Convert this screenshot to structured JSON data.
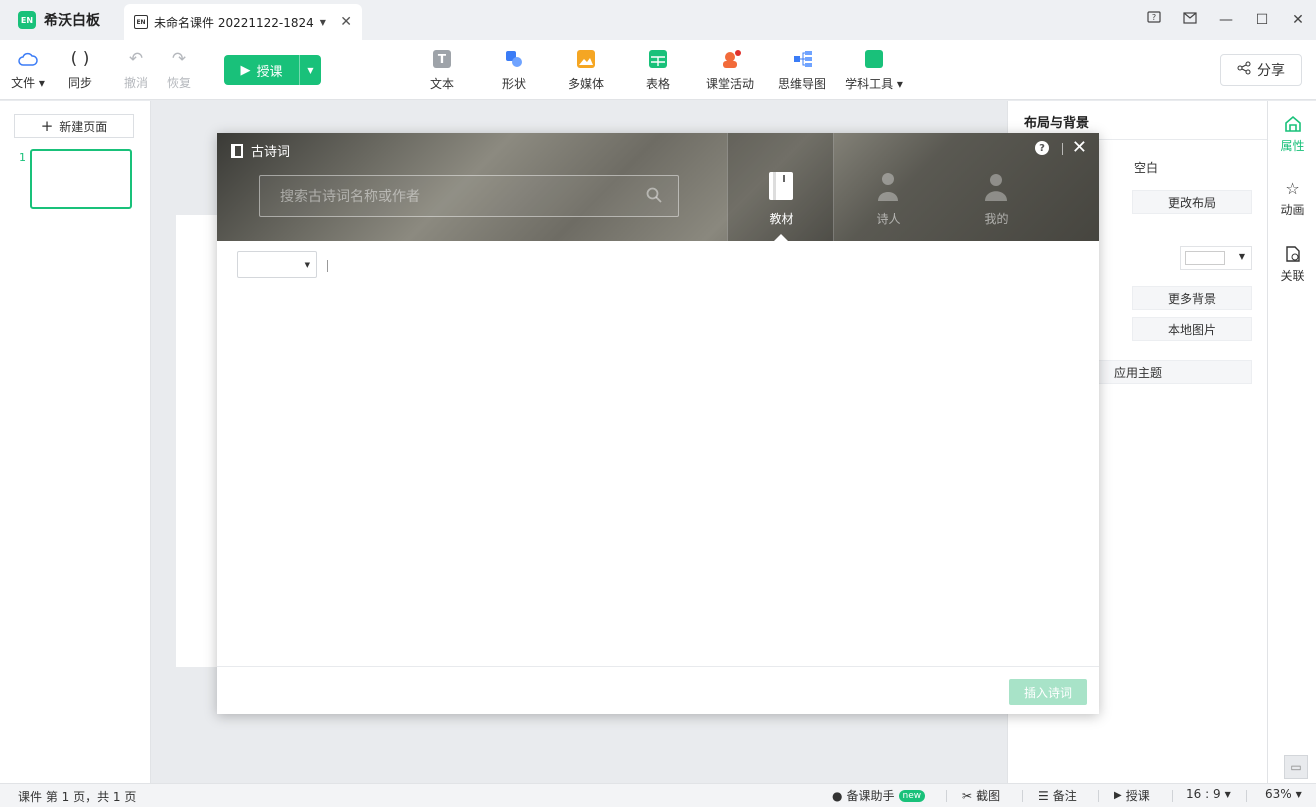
{
  "app": {
    "name": "希沃白板",
    "logo_text": "EN"
  },
  "document_tab": {
    "icon_text": "EN",
    "title": "未命名课件 20221122-1824"
  },
  "toolbar": {
    "file": "文件",
    "sync": "同步",
    "undo": "撤消",
    "redo": "恢复",
    "teach": "授课",
    "insert_items": [
      {
        "label": "文本",
        "icon": "text-icon",
        "color": "#9ea3a9"
      },
      {
        "label": "形状",
        "icon": "shape-icon",
        "color": "#3b7cf6"
      },
      {
        "label": "多媒体",
        "icon": "media-icon",
        "color": "#f5a623"
      },
      {
        "label": "表格",
        "icon": "table-icon",
        "color": "#19c17a"
      },
      {
        "label": "课堂活动",
        "icon": "activity-icon",
        "color": "#f26b3a"
      },
      {
        "label": "思维导图",
        "icon": "mindmap-icon",
        "color": "#3b7cf6"
      },
      {
        "label": "学科工具",
        "icon": "subject-tools-icon",
        "color": "#19c17a"
      }
    ],
    "share": "分享"
  },
  "left_panel": {
    "new_page": "新建页面",
    "page_number": "1"
  },
  "properties": {
    "title": "布局与背景",
    "layout_name": "空白",
    "change_layout": "更改布局",
    "more_backgrounds": "更多背景",
    "local_image": "本地图片",
    "apply_theme": "应用主题"
  },
  "side_tabs": [
    {
      "label": "属性",
      "icon": "properties-icon",
      "active": true
    },
    {
      "label": "动画",
      "icon": "star-icon",
      "active": false
    },
    {
      "label": "关联",
      "icon": "link-icon",
      "active": false
    }
  ],
  "statusbar": {
    "page_info": "课件 第 1 页，共 1 页",
    "assistant": "备课助手",
    "new_badge": "new",
    "screenshot": "截图",
    "notes": "备注",
    "teach": "授课",
    "ratio": "16 : 9",
    "zoom": "63%"
  },
  "dialog": {
    "title": "古诗词",
    "search_placeholder": "搜索古诗词名称或作者",
    "tabs": [
      {
        "label": "教材",
        "active": true
      },
      {
        "label": "诗人",
        "active": false
      },
      {
        "label": "我的",
        "active": false
      }
    ],
    "insert_button": "插入诗词"
  }
}
